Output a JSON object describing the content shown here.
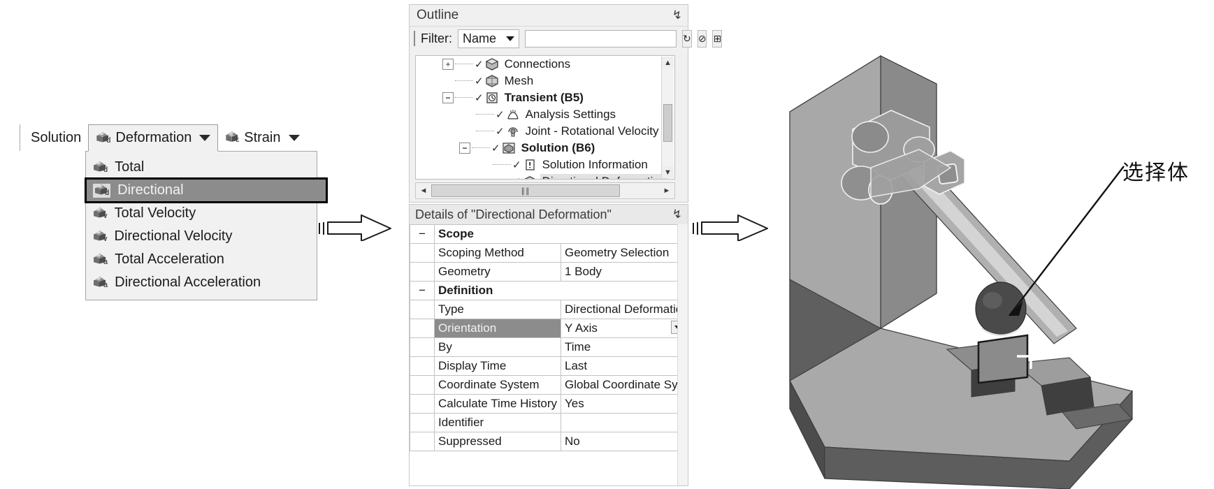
{
  "toolbar": {
    "solution_label": "Solution",
    "deformation_label": "Deformation",
    "strain_label": "Strain",
    "deformation_icon_sub": "d",
    "strain_icon_sub": "ε"
  },
  "dropdown": {
    "items": [
      {
        "label": "Total",
        "sub": "d",
        "selected": false
      },
      {
        "label": "Directional",
        "sub": "d",
        "selected": true
      },
      {
        "label": "Total Velocity",
        "sub": "v",
        "selected": false
      },
      {
        "label": "Directional Velocity",
        "sub": "v",
        "selected": false
      },
      {
        "label": "Total Acceleration",
        "sub": "a",
        "selected": false
      },
      {
        "label": "Directional Acceleration",
        "sub": "a",
        "selected": false
      }
    ]
  },
  "outline": {
    "title": "Outline",
    "pin": "↯",
    "filter_label": "Filter:",
    "filter_value": "Name",
    "filter_input_value": "",
    "filter_input_placeholder": "",
    "refresh_icon": "↻",
    "clear_icon": "⊘",
    "expand_icon": "⊞",
    "scroll_up": "▲",
    "scroll_down": "▼",
    "scroll_left": "◄",
    "scroll_right": "►",
    "scroll_grip": "‖‖",
    "tree": [
      {
        "label": "Connections",
        "indent": 1,
        "expander": "+",
        "bold": false,
        "selected": false,
        "icon": "connections-icon"
      },
      {
        "label": "Mesh",
        "indent": 1,
        "expander": "",
        "bold": false,
        "selected": false,
        "icon": "mesh-icon"
      },
      {
        "label": "Transient (B5)",
        "indent": 1,
        "expander": "−",
        "bold": true,
        "selected": false,
        "icon": "transient-icon"
      },
      {
        "label": "Analysis Settings",
        "indent": 2,
        "expander": "",
        "bold": false,
        "selected": false,
        "icon": "analysis-settings-icon"
      },
      {
        "label": "Joint - Rotational Velocity",
        "indent": 2,
        "expander": "",
        "bold": false,
        "selected": false,
        "icon": "joint-rotational-velocity-icon"
      },
      {
        "label": "Solution (B6)",
        "indent": 2,
        "expander": "−",
        "bold": true,
        "selected": false,
        "icon": "solution-icon"
      },
      {
        "label": "Solution Information",
        "indent": 3,
        "expander": "",
        "bold": false,
        "selected": false,
        "icon": "solution-information-icon"
      },
      {
        "label": "Directional Deformation",
        "indent": 3,
        "expander": "",
        "bold": false,
        "selected": true,
        "icon": "directional-deformation-icon"
      }
    ]
  },
  "details": {
    "title": "Details of \"Directional Deformation\"",
    "pin": "↯",
    "rows": [
      {
        "kind": "group",
        "expander": "−",
        "key": "Scope",
        "value": ""
      },
      {
        "kind": "row",
        "key": "Scoping Method",
        "value": "Geometry Selection",
        "highlight": false,
        "dropdown": false
      },
      {
        "kind": "row",
        "key": "Geometry",
        "value": "1 Body",
        "highlight": false,
        "dropdown": false
      },
      {
        "kind": "group",
        "expander": "−",
        "key": "Definition",
        "value": ""
      },
      {
        "kind": "row",
        "key": "Type",
        "value": "Directional Deformation",
        "highlight": false,
        "dropdown": false
      },
      {
        "kind": "row",
        "key": "Orientation",
        "value": "Y Axis",
        "highlight": true,
        "dropdown": true
      },
      {
        "kind": "row",
        "key": "By",
        "value": "Time",
        "highlight": false,
        "dropdown": false
      },
      {
        "kind": "row",
        "key": "Display Time",
        "value": "Last",
        "highlight": false,
        "dropdown": false
      },
      {
        "kind": "row",
        "key": "Coordinate System",
        "value": "Global Coordinate System",
        "highlight": false,
        "dropdown": false
      },
      {
        "kind": "row",
        "key": "Calculate Time History",
        "value": "Yes",
        "highlight": false,
        "dropdown": false
      },
      {
        "kind": "row",
        "key": "Identifier",
        "value": "",
        "highlight": false,
        "dropdown": false
      },
      {
        "kind": "row",
        "key": "Suppressed",
        "value": "No",
        "highlight": false,
        "dropdown": false
      }
    ],
    "dropdown_caret": "▼"
  },
  "annotation": {
    "text": "选择体"
  },
  "colors": {
    "menu_highlight": "#8c8c8c",
    "panel_bg": "#f0f0f0",
    "model_light": "#b4b4b4",
    "model_mid": "#8f8f8f",
    "model_dark": "#5a5a5a",
    "selected_body": "#4a4a4a"
  }
}
